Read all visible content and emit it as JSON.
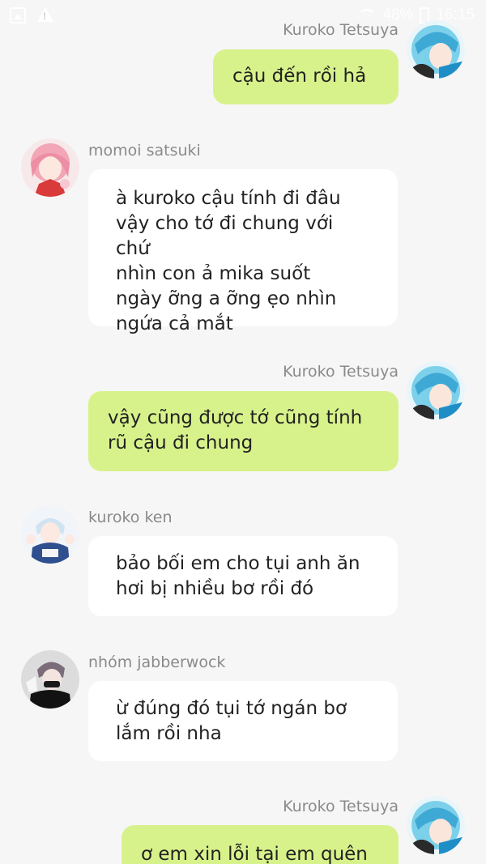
{
  "status_bar": {
    "battery_text": "48%",
    "time": "16:15"
  },
  "messages": [
    {
      "sender": "Kuroko Tetsuya",
      "side": "right",
      "text": "cậu đến rồi hả",
      "avatar_icon": "kuroko-avatar-icon"
    },
    {
      "sender": "momoi satsuki",
      "side": "left",
      "text": "à kuroko cậu tính đi đâu\nvậy cho tớ đi chung với chứ\nnhìn con ả mika suốt\nngày ỡng a ỡng ẹo nhìn\nngứa cả mắt",
      "avatar_icon": "momoi-avatar-icon"
    },
    {
      "sender": "Kuroko Tetsuya",
      "side": "right",
      "text": "vậy cũng được tớ cũng tính\nrũ cậu đi chung",
      "avatar_icon": "kuroko-avatar-icon"
    },
    {
      "sender": "kuroko ken",
      "side": "left",
      "text": "bảo bối em cho tụi anh ăn\nhơi bị nhiều bơ rồi đó",
      "avatar_icon": "ken-avatar-icon"
    },
    {
      "sender": "nhóm jabberwock",
      "side": "left",
      "text": "ừ đúng đó tụi tớ ngán bơ\nlắm rồi nha",
      "avatar_icon": "jabberwock-avatar-icon"
    },
    {
      "sender": "Kuroko Tetsuya",
      "side": "right",
      "text": "ơ em xin lỗi tại em quên",
      "avatar_icon": "kuroko-avatar-icon"
    }
  ],
  "colors": {
    "my_bubble": "#d8f28b",
    "their_bubble": "#ffffff",
    "background": "#f6f6f6",
    "name_text": "#8a8a8a"
  }
}
